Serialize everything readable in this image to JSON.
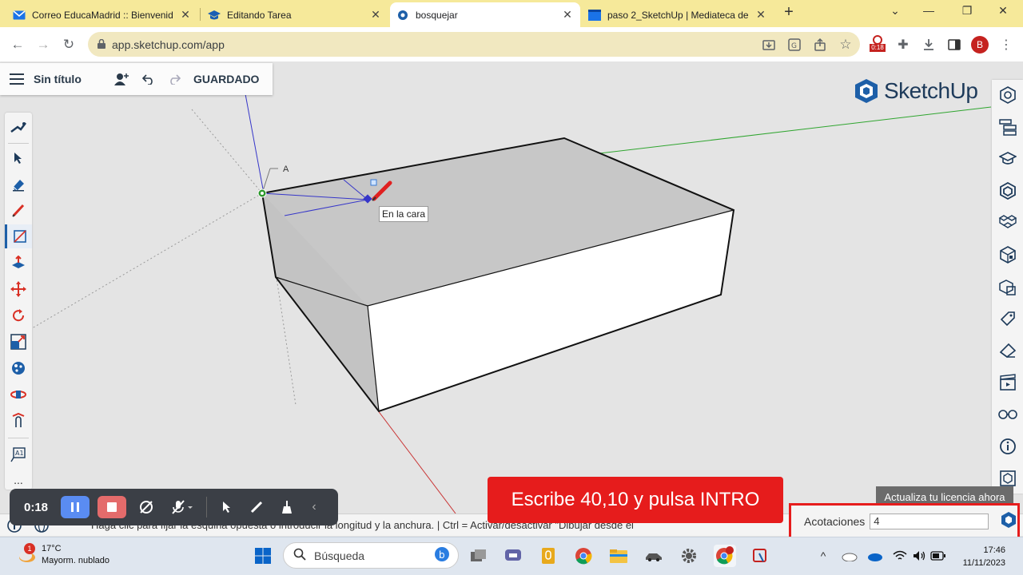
{
  "browser": {
    "tabs": [
      {
        "title": "Correo EducaMadrid :: Bienvenido",
        "icon": "mail-icon"
      },
      {
        "title": "Editando Tarea",
        "icon": "graduation-cap-icon"
      },
      {
        "title": "bosquejar",
        "icon": "sketchup-icon"
      },
      {
        "title": "paso 2_SketchUp | Mediateca de",
        "icon": "video-clapper-icon"
      }
    ],
    "new_tab_label": "+",
    "url": "app.sketchup.com/app",
    "recording_badge": "0:18",
    "profile_initial": "B",
    "colors": {
      "tabbar": "#f6e99a",
      "profile": "#c5221f"
    }
  },
  "sketchup": {
    "document_title": "Sin título",
    "save_status": "GUARDADO",
    "logo_text": "SketchUp",
    "tooltip": "En la cara",
    "point_label": "A",
    "status_text": "Haga clic para fijar la esquina opuesta o introducir la longitud y la anchura. | Ctrl = Activar/desactivar \"Dibujar desde el",
    "measurements_label": "Acotaciones",
    "measurements_value": "4",
    "license_banner": "Actualiza tu licencia ahora",
    "more_tools": "...",
    "left_tools": [
      "search-zoom-icon",
      "select-arrow-icon",
      "eraser-icon",
      "pencil-icon",
      "rectangle-icon",
      "push-pull-icon",
      "move-icon",
      "rotate-icon",
      "scale-icon",
      "paint-bucket-icon",
      "orbit-icon",
      "walk-icon",
      "text-icon"
    ],
    "right_tools": [
      "entity-info-icon",
      "outliner-icon",
      "instructor-icon",
      "components-icon",
      "materials-icon",
      "styles-icon",
      "solid-tools-icon",
      "tags-icon",
      "eraser-panel-icon",
      "scenes-icon",
      "display-icon",
      "help-icon",
      "sketchup-account-icon"
    ]
  },
  "recorder": {
    "time": "0:18",
    "colors": {
      "pause": "#5a8cf2",
      "stop": "#e46b6b"
    }
  },
  "callout": {
    "text": "Escribe 40,10 y pulsa INTRO",
    "color": "#e61c1c"
  },
  "taskbar": {
    "weather_temp": "17°C",
    "weather_desc": "Mayorm. nublado",
    "weather_badge": "1",
    "search_placeholder": "Búsqueda",
    "time": "17:46",
    "date": "11/11/2023"
  }
}
